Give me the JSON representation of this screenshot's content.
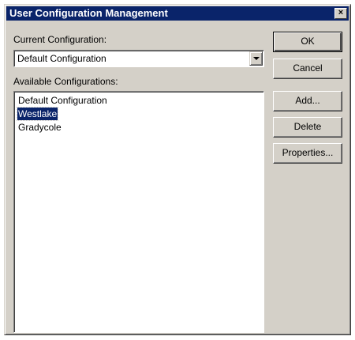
{
  "window": {
    "title": "User Configuration Management",
    "close_glyph": "×"
  },
  "current": {
    "label": "Current Configuration:",
    "value": "Default Configuration"
  },
  "available": {
    "label": "Available Configurations:",
    "items": [
      {
        "label": "Default Configuration",
        "selected": false
      },
      {
        "label": "Westlake",
        "selected": true
      },
      {
        "label": "Gradycole",
        "selected": false
      }
    ]
  },
  "buttons": {
    "ok": "OK",
    "cancel": "Cancel",
    "add": "Add...",
    "delete": "Delete",
    "properties": "Properties..."
  },
  "colors": {
    "titlebar": "#0a246a",
    "face": "#d4d0c8",
    "selection": "#0a246a"
  },
  "icons": {
    "close": "close-icon",
    "dropdown": "chevron-down-icon"
  }
}
